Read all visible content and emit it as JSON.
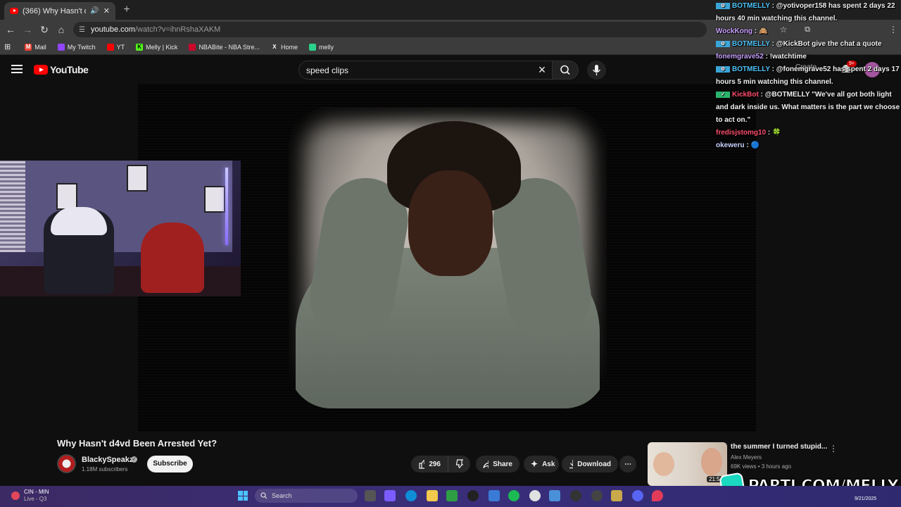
{
  "browser": {
    "tab_title": "(366) Why Hasn't d4vd Been Arrested Yet?",
    "tab_audio_icon": "speaker-icon",
    "url_host": "youtube.com",
    "url_path": "/watch?v=ihnRshaXAKM",
    "bookmarks": [
      {
        "label": "Mail",
        "icon": "gmail-icon",
        "color": "#ea4335"
      },
      {
        "label": "My Twitch",
        "icon": "twitch-icon",
        "color": "#9146ff"
      },
      {
        "label": "YT",
        "icon": "youtube-icon",
        "color": "#ff0000"
      },
      {
        "label": "Melly | Kick",
        "icon": "kick-icon",
        "color": "#53fc18"
      },
      {
        "label": "NBABite - NBA Stre...",
        "icon": "nba-icon",
        "color": "#c9082a"
      },
      {
        "label": "Home",
        "icon": "x-icon",
        "color": "#ffffff"
      },
      {
        "label": "melly",
        "icon": "leaf-icon",
        "color": "#29d18a"
      }
    ]
  },
  "youtube": {
    "logo_text": "YouTube",
    "search_query": "speed clips",
    "create_label": "Create",
    "notification_count": "9+",
    "video": {
      "title": "Why Hasn't d4vd Been Arrested Yet?",
      "channel": "BlackySpeakz",
      "subscribers": "1.18M subscribers",
      "subscribe_label": "Subscribe",
      "likes": "296",
      "share_label": "Share",
      "ask_label": "Ask",
      "download_label": "Download"
    },
    "recommendation": {
      "title": "the summer I turned stupid...",
      "channel": "Alex Meyers",
      "meta": "69K views • 3 hours ago",
      "duration": "21:5"
    }
  },
  "chat": {
    "messages": [
      {
        "user": "BOTMELLY",
        "bot": true,
        "color": "#4fc3f7",
        "text": "@yotivoper158 has spent 2 days 22 hours 40 min watching this channel."
      },
      {
        "user": "WockKong",
        "bot": false,
        "color": "#c9a0ff",
        "text": "🙈"
      },
      {
        "user": "BOTMELLY",
        "bot": true,
        "color": "#4fc3f7",
        "text": "@KickBot give the chat a quote"
      },
      {
        "user": "fonemgrave52",
        "bot": false,
        "color": "#c9a0ff",
        "text": "!watchtime"
      },
      {
        "user": "BOTMELLY",
        "bot": true,
        "color": "#4fc3f7",
        "text": "@fonemgrave52 has spent 2 days 17 hours 5 min watching this channel."
      },
      {
        "user": "KickBot",
        "bot": true,
        "color": "#ff4d6d",
        "text": "@BOTMELLY \"We've all got both light and dark inside us. What matters is the part we choose to act on.\""
      },
      {
        "user": "fredisjstomg10",
        "bot": false,
        "color": "#ff4d6d",
        "text": "🍀"
      },
      {
        "user": "okeweru",
        "bot": false,
        "color": "#c9d3ff",
        "text": "🔵"
      }
    ]
  },
  "watermark": {
    "text": "PARTI.COM/MELLY"
  },
  "taskbar": {
    "weather_title": "CIN - MIN",
    "weather_sub": "Live - Q3",
    "search_placeholder": "Search",
    "date": "9/21/2025"
  },
  "colors": {
    "yt_red": "#ff0000",
    "taskbar_accent": "#3a2e7a",
    "watermark_logo": "#1ad9c0"
  }
}
